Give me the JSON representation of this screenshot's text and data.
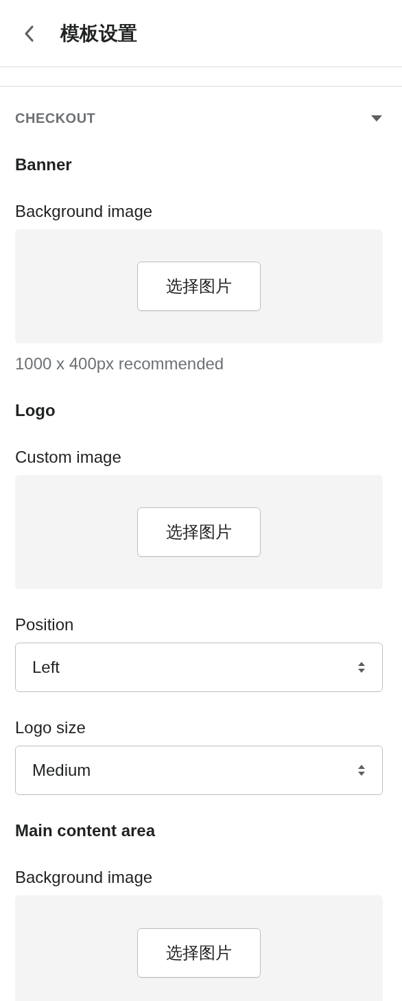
{
  "header": {
    "title": "模板设置"
  },
  "section": {
    "title": "CHECKOUT",
    "expanded": true
  },
  "items": [
    {
      "kind": "heading",
      "text": "Banner"
    },
    {
      "kind": "image",
      "label": "Background image",
      "button": "选择图片",
      "hint": "1000 x 400px recommended"
    },
    {
      "kind": "heading",
      "text": "Logo"
    },
    {
      "kind": "image",
      "label": "Custom image",
      "button": "选择图片"
    },
    {
      "kind": "select",
      "label": "Position",
      "value": "Left"
    },
    {
      "kind": "select",
      "label": "Logo size",
      "value": "Medium"
    },
    {
      "kind": "heading",
      "text": "Main content area"
    },
    {
      "kind": "image",
      "label": "Background image",
      "button": "选择图片"
    }
  ]
}
